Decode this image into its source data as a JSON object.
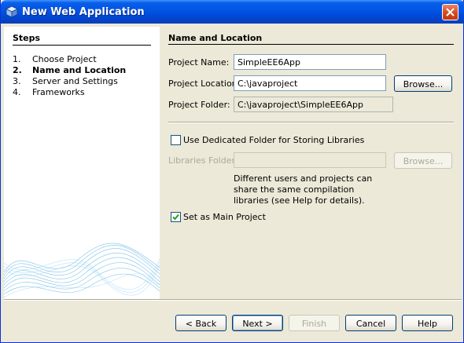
{
  "window": {
    "title": "New Web Application"
  },
  "steps": {
    "heading": "Steps",
    "items": [
      {
        "num": "1.",
        "label": "Choose Project"
      },
      {
        "num": "2.",
        "label": "Name and Location"
      },
      {
        "num": "3.",
        "label": "Server and Settings"
      },
      {
        "num": "4.",
        "label": "Frameworks"
      }
    ],
    "current_index": 1
  },
  "content": {
    "heading": "Name and Location",
    "project_name": {
      "label": "Project Name:",
      "value": "SimpleEE6App"
    },
    "project_location": {
      "label": "Project Location:",
      "value": "C:\\javaproject",
      "browse": "Browse..."
    },
    "project_folder": {
      "label": "Project Folder:",
      "value": "C:\\javaproject\\SimpleEE6App"
    },
    "dedicated_folder": {
      "label": "Use Dedicated Folder for Storing Libraries",
      "checked": false
    },
    "libraries_folder": {
      "label": "Libraries Folder:",
      "value": "",
      "browse": "Browse..."
    },
    "libraries_help": "Different users and projects can share the same compilation libraries (see Help for details).",
    "main_project": {
      "label": "Set as Main Project",
      "checked": true
    }
  },
  "buttons": {
    "back": "< Back",
    "next": "Next >",
    "finish": "Finish",
    "cancel": "Cancel",
    "help": "Help"
  },
  "colors": {
    "titlebar": "#0055e5",
    "close": "#d54a1e",
    "window_bg": "#ece9d8",
    "accent_waves": "#3aa0d8"
  }
}
